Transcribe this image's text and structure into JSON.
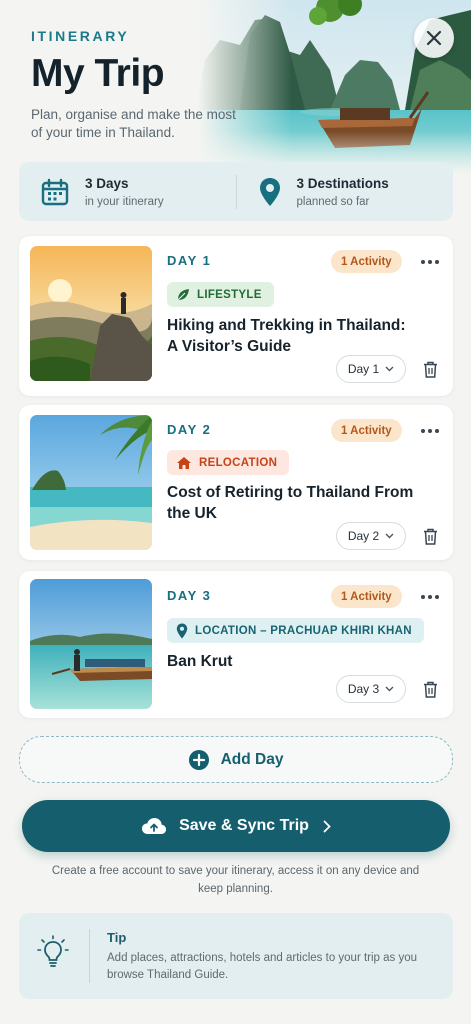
{
  "header": {
    "eyebrow": "ITINERARY",
    "title": "My Trip",
    "subtitle": "Plan, organise and make the most of your time in Thailand."
  },
  "stats": {
    "days_main": "3 Days",
    "days_sub": "in your itinerary",
    "destinations_main": "3 Destinations",
    "destinations_sub": "planned so far"
  },
  "days": [
    {
      "day_label": "DAY 1",
      "activity_count": "1 Activity",
      "tag": "LIFESTYLE",
      "tag_icon": "leaf-icon",
      "title": "Hiking and Trekking in Thailand: A Visitor’s Guide",
      "selected_day": "Day 1"
    },
    {
      "day_label": "DAY 2",
      "activity_count": "1 Activity",
      "tag": "RELOCATION",
      "tag_icon": "house-icon",
      "title": "Cost of Retiring to Thailand From the UK",
      "selected_day": "Day 2"
    },
    {
      "day_label": "DAY 3",
      "activity_count": "1 Activity",
      "tag": "LOCATION – PRACHUAP KHIRI KHAN",
      "tag_icon": "map-pin-icon",
      "title": "Ban Krut",
      "selected_day": "Day 3"
    }
  ],
  "actions": {
    "add_day": "Add Day",
    "save_sync": "Save & Sync Trip",
    "save_note": "Create a free account to save your itinerary, access it on any device and keep planning."
  },
  "tip": {
    "title": "Tip",
    "text": "Add places, attractions, hotels and articles to your trip as you browse Thailand Guide."
  },
  "colors": {
    "brand_teal": "#155e6d",
    "accent_teal": "#1a7a8a",
    "activity_badge_bg": "#fbe6cc",
    "activity_badge_text": "#b4581a"
  }
}
